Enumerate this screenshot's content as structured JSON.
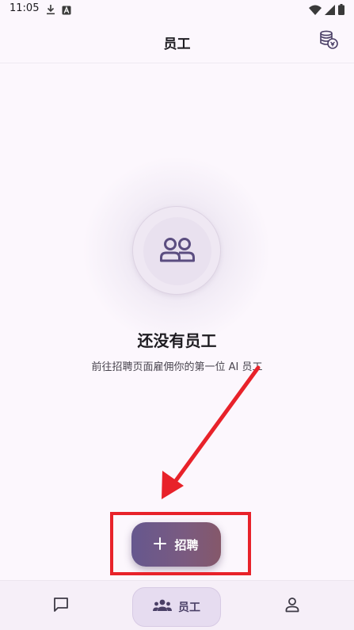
{
  "status_bar": {
    "time": "11:05",
    "left_icons": [
      "download-icon",
      "a-badge-icon"
    ],
    "right_icons": [
      "wifi-icon",
      "signal-icon",
      "battery-icon"
    ]
  },
  "app_bar": {
    "title": "员工",
    "action_icon": "coins-icon"
  },
  "empty_state": {
    "icon": "people-icon",
    "title": "还没有员工",
    "subtitle": "前往招聘页面雇佣你的第一位 AI 员工"
  },
  "fab": {
    "icon": "plus-icon",
    "label": "招聘"
  },
  "bottom_nav": {
    "items": [
      {
        "id": "chat",
        "icon": "chat-icon",
        "label": ""
      },
      {
        "id": "staff",
        "icon": "team-icon",
        "label": "员工",
        "selected": true
      },
      {
        "id": "profile",
        "icon": "person-icon",
        "label": ""
      }
    ]
  },
  "colors": {
    "background": "#fcf7fd",
    "accent": "#66588e",
    "annotation": "#e8222a"
  }
}
